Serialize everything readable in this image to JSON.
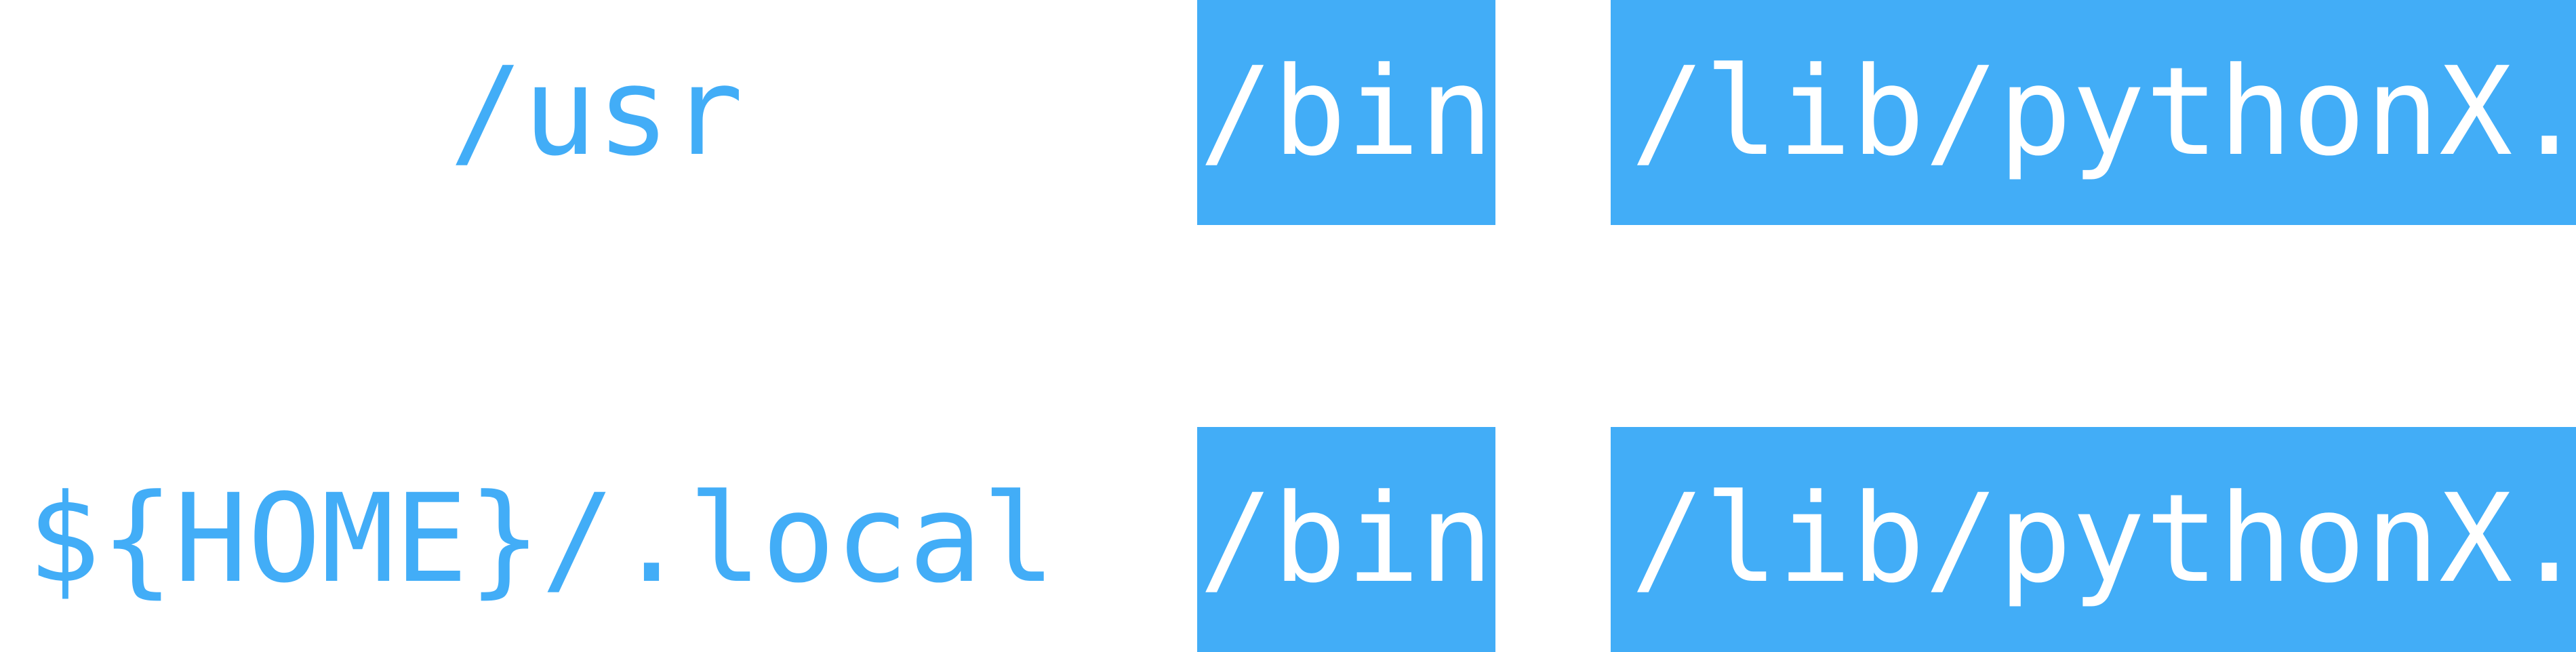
{
  "rows": [
    {
      "prefix": "/usr",
      "bin": "/bin",
      "lib": "/lib/pythonX.Y"
    },
    {
      "prefix": "${HOME}/.local",
      "bin": "/bin",
      "lib": "/lib/pythonX.Y"
    }
  ],
  "colors": {
    "accent": "#42adf7",
    "box_text": "#ffffff",
    "background": "#ffffff"
  }
}
